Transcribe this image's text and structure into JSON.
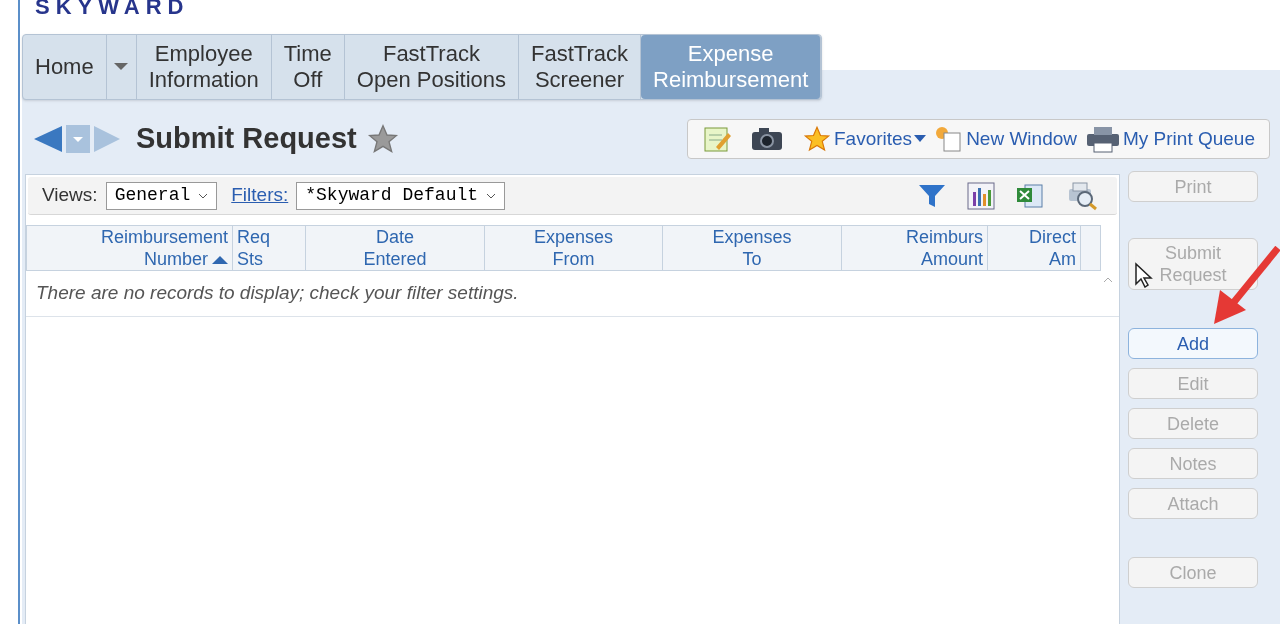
{
  "logo": "SKYWARD",
  "tabs": [
    {
      "lines": [
        "Home"
      ],
      "selected": false
    },
    {
      "lines": [
        "Employee",
        "Information"
      ],
      "selected": false
    },
    {
      "lines": [
        "Time",
        "Off"
      ],
      "selected": false
    },
    {
      "lines": [
        "FastTrack",
        "Open Positions"
      ],
      "selected": false
    },
    {
      "lines": [
        "FastTrack",
        "Screener"
      ],
      "selected": false
    },
    {
      "lines": [
        "Expense",
        "Reimbursement"
      ],
      "selected": true
    }
  ],
  "page_title": "Submit Request",
  "toolbar": [
    {
      "kind": "notes"
    },
    {
      "kind": "camera"
    },
    {
      "kind": "star",
      "label": "Favorites"
    },
    {
      "kind": "window",
      "label": "New Window"
    },
    {
      "kind": "printer",
      "label": "My Print Queue"
    }
  ],
  "views": {
    "label": "Views:",
    "value": "General"
  },
  "filters": {
    "label": "Filters:",
    "value": "*Skyward Default"
  },
  "grid_tools": [
    {
      "kind": "funnel"
    },
    {
      "kind": "chart"
    },
    {
      "kind": "excel"
    },
    {
      "kind": "preview"
    }
  ],
  "table": {
    "columns": [
      {
        "lines": [
          "Reimbursement",
          "Number"
        ],
        "sorted": true
      },
      {
        "lines": [
          "Req",
          "Sts"
        ],
        "sorted": false
      },
      {
        "lines": [
          "Date",
          "Entered"
        ],
        "sorted": false
      },
      {
        "lines": [
          "Expenses",
          "From"
        ],
        "sorted": false
      },
      {
        "lines": [
          "Expenses",
          "To"
        ],
        "sorted": false
      },
      {
        "lines": [
          "Reimburs",
          "Amount"
        ],
        "sorted": false
      },
      {
        "lines": [
          "Direct",
          "Am"
        ],
        "sorted": false
      }
    ],
    "empty_message": "There are no records to display; check your filter settings."
  },
  "buttons": [
    {
      "label": "Print",
      "disabled": true
    },
    {
      "lines": [
        "Submit",
        "Request"
      ],
      "disabled": true
    },
    {
      "label": "Add",
      "disabled": false
    },
    {
      "label": "Edit",
      "disabled": true
    },
    {
      "label": "Delete",
      "disabled": true
    },
    {
      "label": "Notes",
      "disabled": true
    },
    {
      "label": "Attach",
      "disabled": true
    },
    {
      "label": "Clone",
      "disabled": true
    }
  ]
}
